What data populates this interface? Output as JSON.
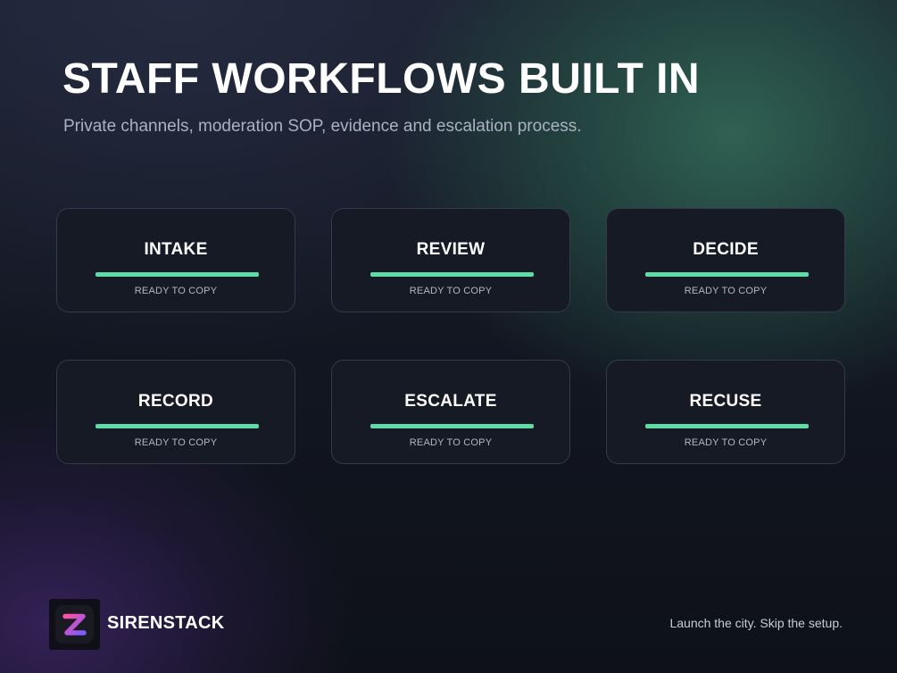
{
  "header": {
    "title": "STAFF WORKFLOWS BUILT IN",
    "subtitle": "Private channels, moderation SOP, evidence and escalation process."
  },
  "cards": [
    {
      "label": "INTAKE",
      "status": "READY TO COPY"
    },
    {
      "label": "REVIEW",
      "status": "READY TO COPY"
    },
    {
      "label": "DECIDE",
      "status": "READY TO COPY"
    },
    {
      "label": "RECORD",
      "status": "READY TO COPY"
    },
    {
      "label": "ESCALATE",
      "status": "READY TO COPY"
    },
    {
      "label": "RECUSE",
      "status": "READY TO COPY"
    }
  ],
  "footer": {
    "logo_icon": "z-logo-icon",
    "brand": "SIRENSTACK",
    "tagline": "Launch the city. Skip the setup."
  },
  "colors": {
    "accent": "#5fdca5",
    "card_background": "#161a25",
    "card_border": "#343a4c",
    "logo_gradient_start": "#ff4fa3",
    "logo_gradient_end": "#7b5cff"
  }
}
